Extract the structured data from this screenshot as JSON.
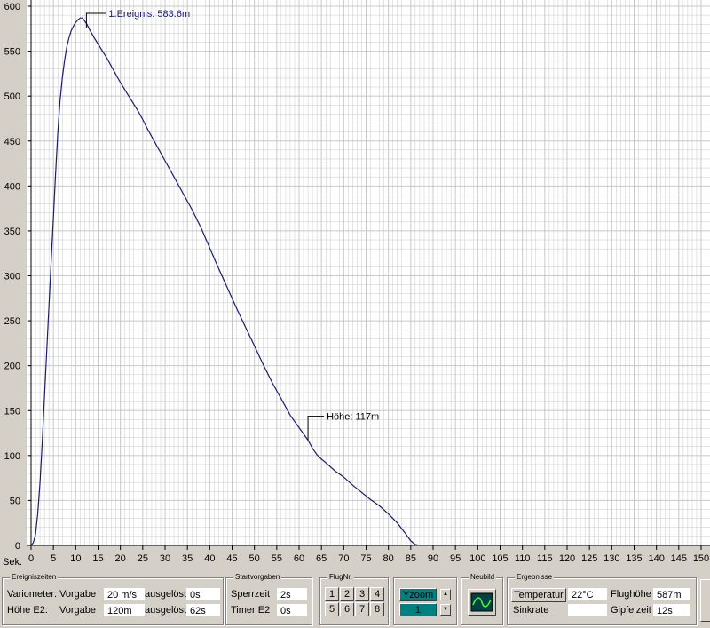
{
  "chart_data": {
    "type": "line",
    "xlim": [
      0,
      150
    ],
    "ylim": [
      0,
      600
    ],
    "x_axis_label": "Sek.",
    "x_ticks": [
      0,
      5,
      10,
      15,
      20,
      25,
      30,
      35,
      40,
      45,
      50,
      55,
      60,
      65,
      70,
      75,
      80,
      85,
      90,
      95,
      100,
      105,
      110,
      115,
      120,
      125,
      130,
      135,
      140,
      145,
      150
    ],
    "y_ticks": [
      0,
      50,
      100,
      150,
      200,
      250,
      300,
      350,
      400,
      450,
      500,
      550,
      600
    ],
    "line_color": "#1c1c6e",
    "grid": true,
    "series": [
      {
        "values": [
          [
            0,
            0
          ],
          [
            0.5,
            3
          ],
          [
            1,
            12
          ],
          [
            1.5,
            35
          ],
          [
            2,
            70
          ],
          [
            2.5,
            115
          ],
          [
            3,
            165
          ],
          [
            3.5,
            215
          ],
          [
            4,
            265
          ],
          [
            4.5,
            315
          ],
          [
            5,
            365
          ],
          [
            5.5,
            415
          ],
          [
            6,
            460
          ],
          [
            6.5,
            495
          ],
          [
            7,
            520
          ],
          [
            7.5,
            540
          ],
          [
            8,
            555
          ],
          [
            8.5,
            565
          ],
          [
            9,
            573
          ],
          [
            9.5,
            578
          ],
          [
            10,
            582
          ],
          [
            10.5,
            585
          ],
          [
            11,
            587
          ],
          [
            11.5,
            587
          ],
          [
            12,
            583.6
          ],
          [
            12.5,
            580
          ],
          [
            13,
            575
          ],
          [
            14,
            566
          ],
          [
            15,
            558
          ],
          [
            16,
            550
          ],
          [
            17,
            542
          ],
          [
            18,
            533
          ],
          [
            19,
            524
          ],
          [
            20,
            515
          ],
          [
            22,
            499
          ],
          [
            24,
            483
          ],
          [
            25,
            474
          ],
          [
            26,
            464
          ],
          [
            28,
            446
          ],
          [
            30,
            428
          ],
          [
            32,
            410
          ],
          [
            34,
            392
          ],
          [
            36,
            374
          ],
          [
            38,
            354
          ],
          [
            40,
            331
          ],
          [
            42,
            308
          ],
          [
            44,
            286
          ],
          [
            46,
            264
          ],
          [
            48,
            243
          ],
          [
            50,
            222
          ],
          [
            52,
            201
          ],
          [
            54,
            181
          ],
          [
            56,
            163
          ],
          [
            58,
            145
          ],
          [
            60,
            131
          ],
          [
            62,
            117
          ],
          [
            63,
            108
          ],
          [
            64,
            101
          ],
          [
            65,
            96
          ],
          [
            66,
            92
          ],
          [
            68,
            83
          ],
          [
            70,
            76
          ],
          [
            72,
            67
          ],
          [
            74,
            59
          ],
          [
            76,
            51
          ],
          [
            78,
            44
          ],
          [
            80,
            35
          ],
          [
            82,
            25
          ],
          [
            84,
            12
          ],
          [
            85,
            5
          ],
          [
            86,
            1
          ],
          [
            87,
            0
          ]
        ]
      }
    ],
    "annotations": [
      {
        "text": "1.Ereignis: 583.6m",
        "x": 12,
        "y": 583.6
      },
      {
        "text": "Höhe: 117m",
        "x": 62,
        "y": 117
      }
    ]
  },
  "panels": {
    "ereigniszeiten": {
      "title": "Ereigniszeiten",
      "row1": {
        "label": "Variometer: Vorgabe",
        "value": "20 m/s",
        "label2": "ausgelöst",
        "value2": "0s"
      },
      "row2": {
        "label": "Höhe E2:",
        "label_b": "Vorgabe",
        "value": "120m",
        "label2": "ausgelöst",
        "value2": "62s"
      }
    },
    "startvorgaben": {
      "title": "Startvorgaben",
      "row1": {
        "label": "Sperrzeit",
        "value": "2s"
      },
      "row2": {
        "label": "Timer E2",
        "value": "0s"
      }
    },
    "flugnr": {
      "title": "FlugNr.",
      "buttons": [
        "1",
        "2",
        "3",
        "4",
        "5",
        "6",
        "7",
        "8"
      ]
    },
    "yzoom": {
      "label": "Yzoom",
      "value": "1",
      "up": "▲",
      "down": "▼"
    },
    "neubild": {
      "title": "Neubild"
    },
    "ergebnisse": {
      "title": "Ergebnisse",
      "temperatur_button": "Temperatur",
      "temperatur_value": "22°C",
      "sinkrate_label": "Sinkrate",
      "sinkrate_value": "",
      "flughoehe_label": "Flughöhe",
      "flughoehe_value": "587m",
      "gipfelzeit_label": "Gipfelzeit",
      "gipfelzeit_value": "12s"
    }
  },
  "colors": {
    "background": "#d4d0c8",
    "plot_bg": "#ffffff",
    "grid": "#c8c8c8",
    "accent_teal": "#008080"
  }
}
